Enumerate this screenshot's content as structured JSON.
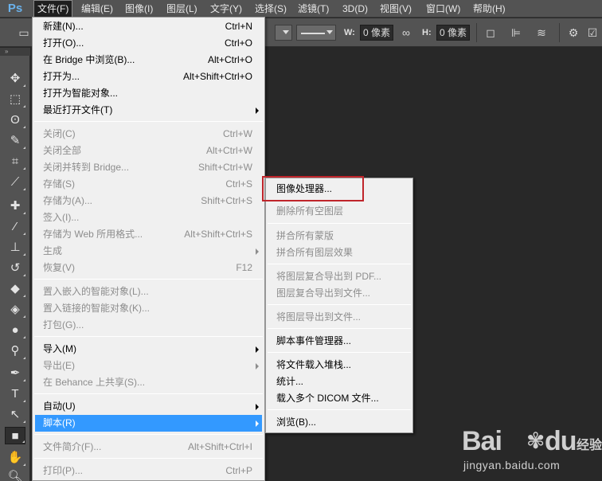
{
  "app": {
    "logo": "Ps"
  },
  "menubar": [
    {
      "label": "文件(F)",
      "active": true
    },
    {
      "label": "编辑(E)"
    },
    {
      "label": "图像(I)"
    },
    {
      "label": "图层(L)"
    },
    {
      "label": "文字(Y)"
    },
    {
      "label": "选择(S)"
    },
    {
      "label": "滤镜(T)"
    },
    {
      "label": "3D(D)"
    },
    {
      "label": "视图(V)"
    },
    {
      "label": "窗口(W)"
    },
    {
      "label": "帮助(H)"
    }
  ],
  "options": {
    "w_label": "W:",
    "w_value": "0 像素",
    "h_label": "H:",
    "h_value": "0 像素"
  },
  "tools": [
    "move-tool",
    "marquee-tool",
    "lasso-tool",
    "quick-selection-tool",
    "crop-tool",
    "eyedropper-tool",
    "spot-healing-tool",
    "brush-tool",
    "clone-stamp-tool",
    "history-brush-tool",
    "eraser-tool",
    "paint-bucket-tool",
    "blur-tool",
    "dodge-tool",
    "pen-tool",
    "type-tool",
    "path-selection-tool",
    "rectangle-tool",
    "hand-tool",
    "zoom-tool"
  ],
  "file_menu": [
    {
      "label": "新建(N)...",
      "shortcut": "Ctrl+N"
    },
    {
      "label": "打开(O)...",
      "shortcut": "Ctrl+O"
    },
    {
      "label": "在 Bridge 中浏览(B)...",
      "shortcut": "Alt+Ctrl+O"
    },
    {
      "label": "打开为...",
      "shortcut": "Alt+Shift+Ctrl+O"
    },
    {
      "label": "打开为智能对象..."
    },
    {
      "label": "最近打开文件(T)",
      "submenu": true
    },
    {
      "divider": true
    },
    {
      "label": "关闭(C)",
      "shortcut": "Ctrl+W",
      "disabled": true
    },
    {
      "label": "关闭全部",
      "shortcut": "Alt+Ctrl+W",
      "disabled": true
    },
    {
      "label": "关闭并转到 Bridge...",
      "shortcut": "Shift+Ctrl+W",
      "disabled": true
    },
    {
      "label": "存储(S)",
      "shortcut": "Ctrl+S",
      "disabled": true
    },
    {
      "label": "存储为(A)...",
      "shortcut": "Shift+Ctrl+S",
      "disabled": true
    },
    {
      "label": "签入(I)...",
      "disabled": true
    },
    {
      "label": "存储为 Web 所用格式...",
      "shortcut": "Alt+Shift+Ctrl+S",
      "disabled": true
    },
    {
      "label": "生成",
      "submenu": true,
      "disabled": true
    },
    {
      "label": "恢复(V)",
      "shortcut": "F12",
      "disabled": true
    },
    {
      "divider": true
    },
    {
      "label": "置入嵌入的智能对象(L)...",
      "disabled": true
    },
    {
      "label": "置入链接的智能对象(K)...",
      "disabled": true
    },
    {
      "label": "打包(G)...",
      "disabled": true
    },
    {
      "divider": true
    },
    {
      "label": "导入(M)",
      "submenu": true
    },
    {
      "label": "导出(E)",
      "submenu": true,
      "disabled": true
    },
    {
      "label": "在 Behance 上共享(S)...",
      "disabled": true
    },
    {
      "divider": true
    },
    {
      "label": "自动(U)",
      "submenu": true
    },
    {
      "label": "脚本(R)",
      "submenu": true,
      "highlight": true
    },
    {
      "divider": true
    },
    {
      "label": "文件简介(F)...",
      "shortcut": "Alt+Shift+Ctrl+I",
      "disabled": true
    },
    {
      "divider": true
    },
    {
      "label": "打印(P)...",
      "shortcut": "Ctrl+P",
      "disabled": true
    }
  ],
  "scripts_menu": [
    {
      "label": "图像处理器...",
      "boxed": true
    },
    {
      "label": "删除所有空图层",
      "disabled": true
    },
    {
      "divider": true
    },
    {
      "label": "拼合所有蒙版",
      "disabled": true
    },
    {
      "label": "拼合所有图层效果",
      "disabled": true
    },
    {
      "divider": true
    },
    {
      "label": "将图层复合导出到 PDF...",
      "disabled": true
    },
    {
      "label": "图层复合导出到文件...",
      "disabled": true
    },
    {
      "divider": true
    },
    {
      "label": "将图层导出到文件...",
      "disabled": true
    },
    {
      "divider": true
    },
    {
      "label": "脚本事件管理器..."
    },
    {
      "divider": true
    },
    {
      "label": "将文件载入堆栈..."
    },
    {
      "label": "统计..."
    },
    {
      "label": "载入多个 DICOM 文件..."
    },
    {
      "divider": true
    },
    {
      "label": "浏览(B)..."
    }
  ],
  "watermark": {
    "brand_left": "Bai",
    "brand_right": "du",
    "jingyan": "经验",
    "url": "jingyan.baidu.com"
  }
}
